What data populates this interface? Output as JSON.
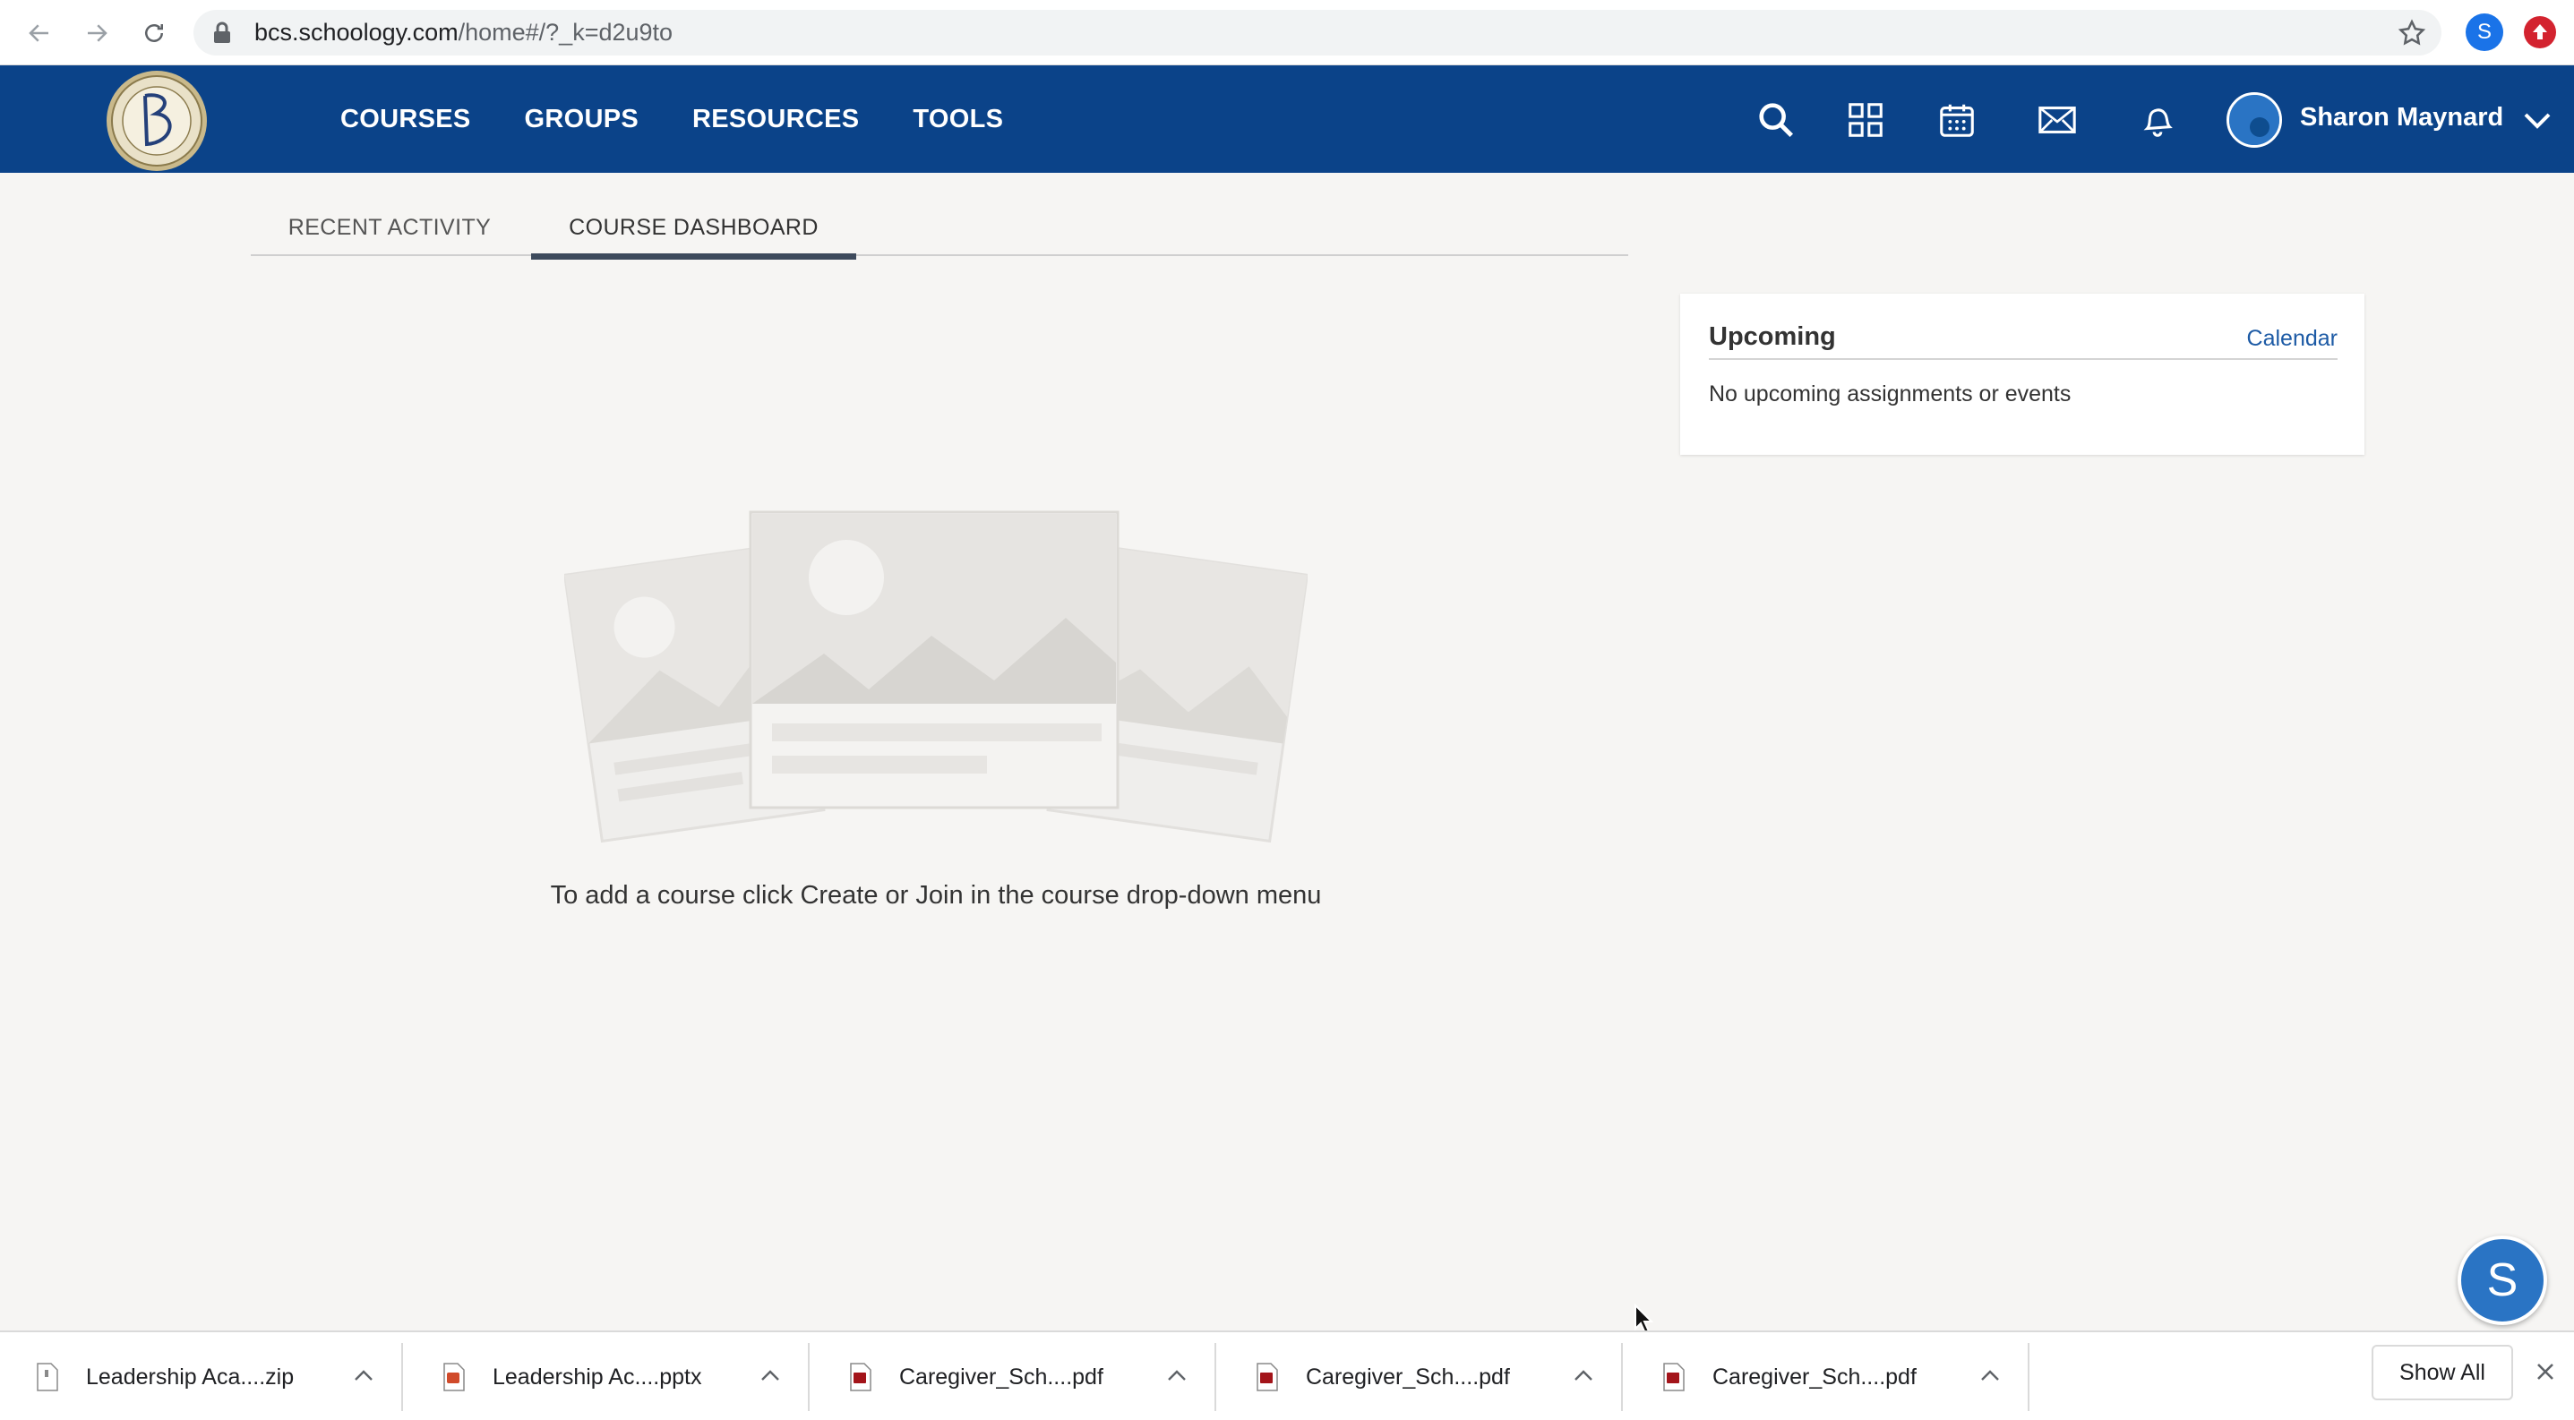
{
  "browser": {
    "url_host": "bcs.schoology.com",
    "url_path": "/home#/?_k=d2u9to",
    "profile_initial": "S",
    "back_icon": "arrow-left-icon",
    "forward_icon": "arrow-right-icon",
    "reload_icon": "reload-icon",
    "lock_icon": "lock-icon",
    "bookmark_icon": "star-icon"
  },
  "header": {
    "brand_color": "#0b4389",
    "nav": [
      {
        "label": "COURSES"
      },
      {
        "label": "GROUPS"
      },
      {
        "label": "RESOURCES"
      },
      {
        "label": "TOOLS"
      }
    ],
    "icons": [
      "search-icon",
      "apps-grid-icon",
      "calendar-icon",
      "mail-icon",
      "notification-bell-icon"
    ],
    "user_name": "Sharon Maynard"
  },
  "tabs": [
    {
      "label": "RECENT ACTIVITY",
      "active": false
    },
    {
      "label": "COURSE DASHBOARD",
      "active": true
    }
  ],
  "main": {
    "empty_message": "To add a course click Create or Join in the course drop-down menu"
  },
  "upcoming": {
    "title": "Upcoming",
    "link": "Calendar",
    "empty_text": "No upcoming assignments or events"
  },
  "help": {
    "label": "S"
  },
  "downloads": {
    "items": [
      {
        "name": "Leadership Aca....zip",
        "type": "zip"
      },
      {
        "name": "Leadership Ac....pptx",
        "type": "pptx"
      },
      {
        "name": "Caregiver_Sch....pdf",
        "type": "pdf"
      },
      {
        "name": "Caregiver_Sch....pdf",
        "type": "pdf"
      },
      {
        "name": "Caregiver_Sch....pdf",
        "type": "pdf"
      }
    ],
    "show_all": "Show All"
  }
}
